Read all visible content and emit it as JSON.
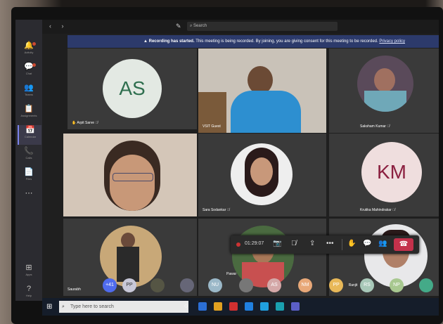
{
  "topbar": {
    "search_placeholder": "Search"
  },
  "banner": {
    "title": "Recording has started.",
    "message": "This meeting is being recorded. By joining, you are giving consent for this meeting to be recorded.",
    "link": "Privacy policy"
  },
  "rail": [
    {
      "icon": "bell-icon",
      "label": "Activity",
      "glyph": "🔔"
    },
    {
      "icon": "chat-icon",
      "label": "Chat",
      "glyph": "💬"
    },
    {
      "icon": "teams-icon",
      "label": "Teams",
      "glyph": "👥"
    },
    {
      "icon": "assignments-icon",
      "label": "Assignments",
      "glyph": "📋"
    },
    {
      "icon": "calendar-icon",
      "label": "Calendar",
      "glyph": "📅"
    },
    {
      "icon": "calls-icon",
      "label": "Calls",
      "glyph": "📞"
    },
    {
      "icon": "files-icon",
      "label": "Files",
      "glyph": "📄"
    },
    {
      "icon": "more-icon",
      "label": "",
      "glyph": "⋯"
    },
    {
      "icon": "apps-icon",
      "label": "Apps",
      "glyph": "⊞"
    },
    {
      "icon": "help-icon",
      "label": "Help",
      "glyph": "?"
    }
  ],
  "tiles": [
    {
      "name": "Arpit Sarve",
      "initials": "AS",
      "color": "#e3e9e3",
      "text_color": "#2f6f4f"
    },
    {
      "name": "VSIT Guest",
      "initials": "",
      "color": "#4a90c0"
    },
    {
      "name": "Saksham Kumar",
      "initials": "",
      "color": "#6a5a70"
    },
    {
      "name": "",
      "initials": "",
      "color": "#d8c8b8"
    },
    {
      "name": "Sara Sodankar",
      "initials": "",
      "color": "#2a2a2a"
    },
    {
      "name": "Krutika Mahindrakar",
      "initials": "KM",
      "color": "#efdede",
      "text_color": "#8b2040"
    },
    {
      "name": "Saurabh",
      "initials": "",
      "color": "#b8a070"
    },
    {
      "name": "Pawar",
      "initials": "",
      "color": "#5a7a50"
    },
    {
      "name": "",
      "initials": "",
      "color": "#6b4b4b"
    }
  ],
  "controls": {
    "timer": "01:29:07"
  },
  "strip": [
    {
      "text": "+41",
      "color": "#4f6bed"
    },
    {
      "text": "PP",
      "color": "#c8c8d8"
    },
    {
      "text": "",
      "color": "#554"
    },
    {
      "text": "",
      "color": "#667"
    },
    {
      "text": "NU",
      "color": "#9bb8c8"
    },
    {
      "text": "",
      "color": "#777"
    },
    {
      "text": "AS",
      "color": "#d4a8a8"
    },
    {
      "text": "NM",
      "color": "#e8a878"
    },
    {
      "text": "PP",
      "color": "#e8b858"
    },
    {
      "text": "Ranjit",
      "color": ""
    },
    {
      "text": "RS",
      "color": "#a8c8b8"
    },
    {
      "text": "NP",
      "color": "#a8c890"
    },
    {
      "text": "",
      "color": "#4a8"
    }
  ],
  "taskbar": {
    "search_placeholder": "Type here to search"
  }
}
